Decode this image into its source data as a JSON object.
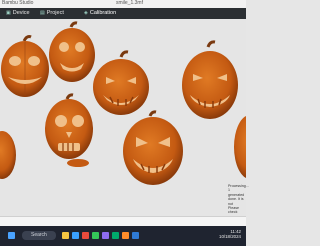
{
  "window": {
    "app_name": "Bambu Studio",
    "file_name": "smile_1.3mf"
  },
  "tabs": [
    {
      "icon": "device-icon",
      "label": "Device"
    },
    {
      "icon": "project-icon",
      "label": "Project"
    },
    {
      "icon": "calibration-icon",
      "label": "Calibration"
    }
  ],
  "viewport": {
    "notice_lines": [
      "Processing...",
      "1 generated",
      "done. It is not",
      "Please check"
    ]
  },
  "status_bar": {
    "text": ""
  },
  "taskbar": {
    "search_label": "Search",
    "tray_time": "11:42",
    "tray_date": "10/18/2024"
  },
  "colors": {
    "pumpkin": "#c45a12",
    "pumpkin_light": "#e07a24",
    "face_hole": "#f0c08a",
    "stem": "#7a3a10"
  }
}
